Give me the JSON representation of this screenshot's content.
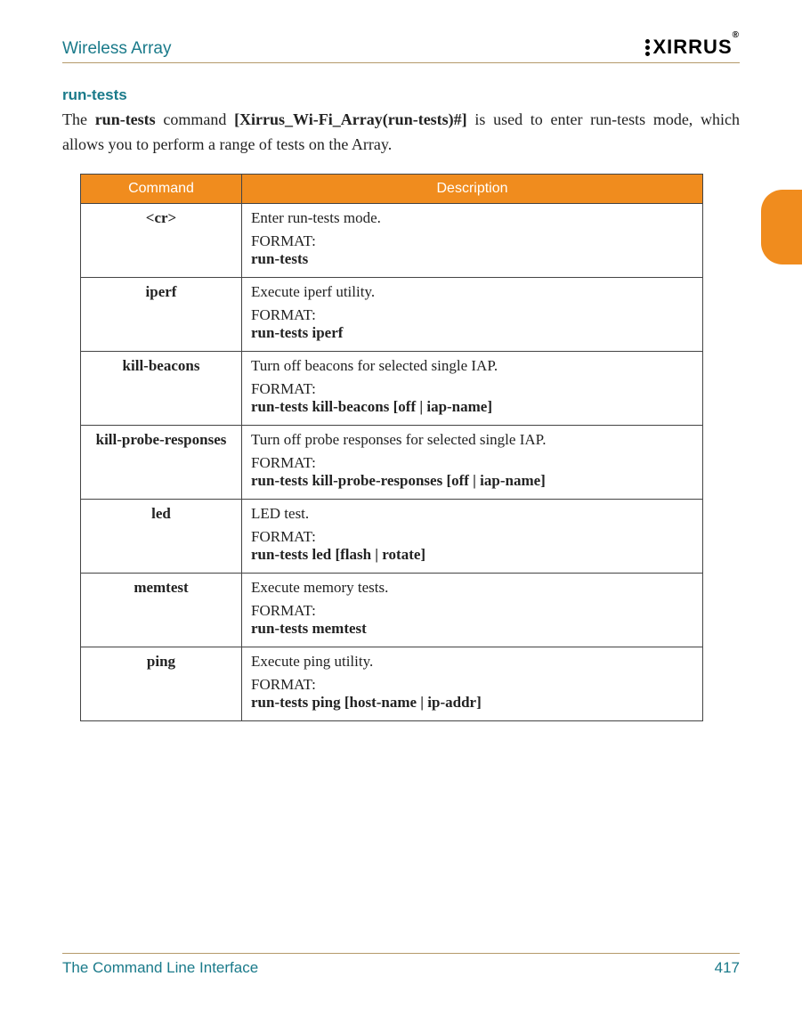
{
  "header": {
    "doc_title": "Wireless Array",
    "logo_text": "XIRRUS",
    "logo_reg": "®"
  },
  "section": {
    "title": "run-tests",
    "intro_parts": {
      "p1": "The ",
      "b1": "run-tests",
      "p2": " command ",
      "b2": "[Xirrus_Wi-Fi_Array(run-tests)#]",
      "p3": " is used to enter run-tests mode, which allows you to perform a range of tests on the Array."
    }
  },
  "table": {
    "head_cmd": "Command",
    "head_desc": "Description",
    "rows": [
      {
        "cmd": "<cr>",
        "desc": "Enter run-tests mode.",
        "fmt_label": "FORMAT:",
        "fmt": "run-tests"
      },
      {
        "cmd": "iperf",
        "desc": " Execute iperf utility.",
        "fmt_label": "FORMAT:",
        "fmt": "run-tests iperf"
      },
      {
        "cmd": "kill-beacons",
        "desc": "Turn off beacons for selected single IAP.",
        "fmt_label": "FORMAT:",
        "fmt": "run-tests kill-beacons [off | iap-name]"
      },
      {
        "cmd": "kill-probe-responses",
        "desc": " Turn off probe responses for selected single IAP.",
        "fmt_label": "FORMAT:",
        "fmt": "run-tests kill-probe-responses [off | iap-name]"
      },
      {
        "cmd": "led",
        "desc": "LED test.",
        "fmt_label": "FORMAT:",
        "fmt": "run-tests led [flash | rotate]"
      },
      {
        "cmd": "memtest",
        "desc": " Execute memory tests.",
        "fmt_label": "FORMAT:",
        "fmt": "run-tests memtest"
      },
      {
        "cmd": "ping",
        "desc": " Execute ping utility.",
        "fmt_label": "FORMAT:",
        "fmt": "run-tests ping [host-name | ip-addr]"
      }
    ]
  },
  "footer": {
    "section": "The Command Line Interface",
    "page": "417"
  }
}
